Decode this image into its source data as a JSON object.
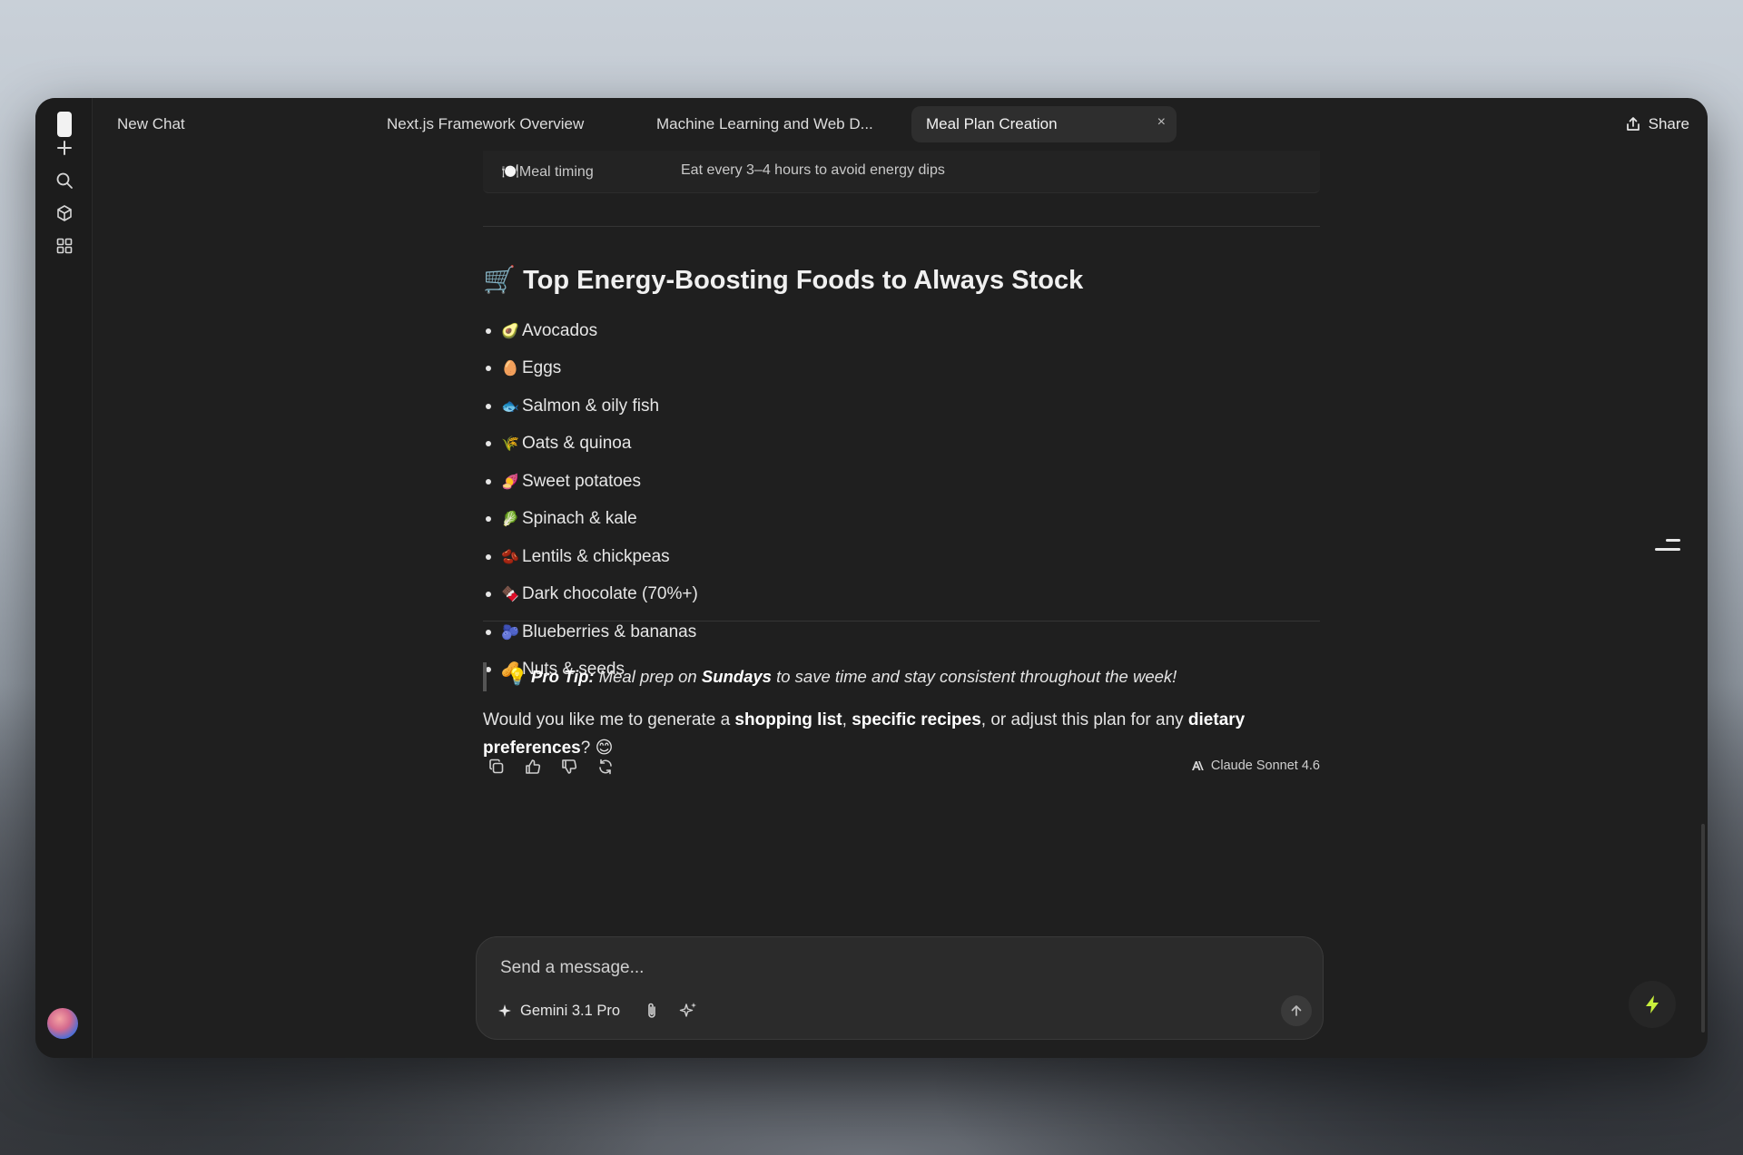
{
  "tabs": {
    "new_chat": "New Chat",
    "items": [
      {
        "label": "Next.js Framework Overview"
      },
      {
        "label": "Machine Learning and Web D..."
      },
      {
        "label": "Meal Plan Creation"
      }
    ],
    "close": "×"
  },
  "header": {
    "share_label": "Share"
  },
  "sidebar": {
    "icons": [
      "plus-icon",
      "search-icon",
      "cube-icon",
      "grid-icon"
    ]
  },
  "table": {
    "row": {
      "emoji": "🍽️",
      "label": "Meal timing",
      "value": "Eat every 3–4 hours to avoid energy dips"
    }
  },
  "section": {
    "emoji": "🛒",
    "heading": "Top Energy-Boosting Foods to Always Stock"
  },
  "foods": [
    {
      "emoji": "🥑",
      "label": "Avocados"
    },
    {
      "emoji": "🥚",
      "label": "Eggs"
    },
    {
      "emoji": "🐟",
      "label": "Salmon & oily fish"
    },
    {
      "emoji": "🌾",
      "label": "Oats & quinoa"
    },
    {
      "emoji": "🍠",
      "label": "Sweet potatoes"
    },
    {
      "emoji": "🥬",
      "label": "Spinach & kale"
    },
    {
      "emoji": "🫘",
      "label": "Lentils & chickpeas"
    },
    {
      "emoji": "🍫",
      "label": "Dark chocolate (70%+)"
    },
    {
      "emoji": "🫐",
      "label": "Blueberries & bananas"
    },
    {
      "emoji": "🥜",
      "label": "Nuts & seeds"
    }
  ],
  "tip": {
    "emoji": "💡",
    "label": "Pro Tip:",
    "text_before": " Meal prep on ",
    "bold": "Sundays",
    "text_after": " to save time and stay consistent throughout the week!"
  },
  "followup": {
    "t1": "Would you like me to generate a ",
    "b1": "shopping list",
    "t2": ", ",
    "b2": "specific recipes",
    "t3": ", or adjust this plan for any ",
    "b3": "dietary preferences",
    "t4": "? ",
    "emoji": "😊"
  },
  "message_meta": {
    "model": "Claude Sonnet 4.6"
  },
  "composer": {
    "placeholder": "Send a message...",
    "model": "Gemini 3.1 Pro"
  }
}
